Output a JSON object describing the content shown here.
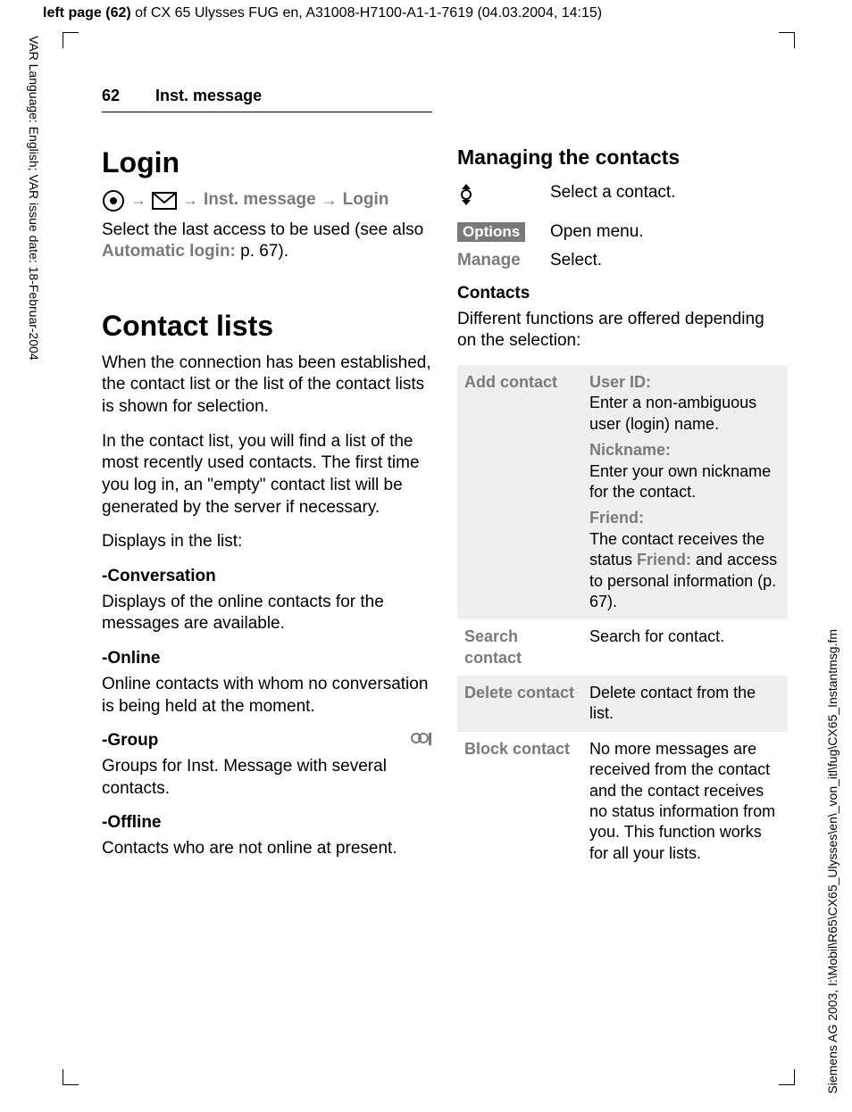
{
  "meta": {
    "top_header_bold": "left page (62)",
    "top_header_rest": " of CX 65 Ulysses FUG en, A31008-H7100-A1-1-7619 (04.03.2004, 14:15)",
    "left_margin": "VAR Language: English; VAR issue date: 18-Februar-2004",
    "right_margin": "Siemens AG 2003, I:\\Mobil\\R65\\CX65_Ulysses\\en\\_von_itl\\fug\\CX65_Instantmsg.fm"
  },
  "header": {
    "page_num": "62",
    "page_title": "Inst. message"
  },
  "left": {
    "login_h": "Login",
    "nav": {
      "step1": "Inst. message",
      "step2": "Login"
    },
    "login_p1a": "Select the last access to be used (see also ",
    "login_p1b": "Automatic login:",
    "login_p1c": " p. 67).",
    "contact_h": "Contact lists",
    "cl_p1": "When the connection has been established, the contact list or the list of the contact lists is shown for selection.",
    "cl_p2": "In the contact list, you will find a list of the most recently used contacts. The first time you log in, an \"empty\" contact list will be generated by the server if necessary.",
    "cl_p3": "Displays in the list:",
    "conv_h": "-Conversation",
    "conv_p": "Displays of the online contacts for the messages are available.",
    "online_h": "-Online",
    "online_p": "Online contacts with whom no conversation is being held at the moment.",
    "group_h": "-Group",
    "group_p": "Groups for Inst. Message with several contacts.",
    "offline_h": "-Offline",
    "offline_p": "Contacts who are not online at present."
  },
  "right": {
    "manage_h": "Managing the contacts",
    "row1_val": "Select a contact.",
    "row2_key": "Options",
    "row2_val": "Open menu.",
    "row3_key": "Manage",
    "row3_val": "Select.",
    "contacts_h": "Contacts",
    "contacts_p": "Different functions are offered depending on the selection:",
    "table": {
      "r1": {
        "key": "Add contact",
        "f1_label": "User ID:",
        "f1_text": "Enter a non-ambiguous user (login) name.",
        "f2_label": "Nickname:",
        "f2_text": "Enter your own nickname for the contact.",
        "f3_label": "Friend:",
        "f3_text_a": "The contact receives the status ",
        "f3_text_b": "Friend:",
        "f3_text_c": " and access to personal information (p. 67)."
      },
      "r2": {
        "key": "Search contact",
        "val": "Search for contact."
      },
      "r3": {
        "key": "Delete contact",
        "val": "Delete contact from the list."
      },
      "r4": {
        "key": "Block contact",
        "val": "No more messages are received from the contact and the contact receives no status information from you. This function works for all your lists."
      }
    }
  }
}
